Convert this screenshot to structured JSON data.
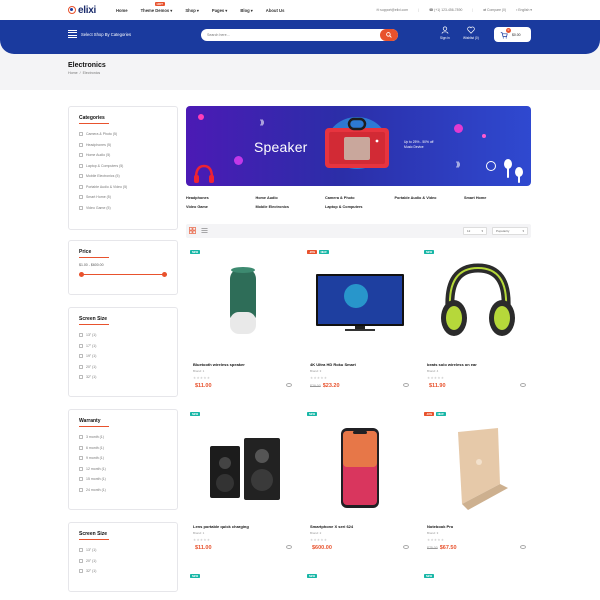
{
  "brand": {
    "logo_text": "elixi"
  },
  "nav": {
    "items": [
      {
        "label": "Home"
      },
      {
        "label": "Theme Demos"
      },
      {
        "label": "Shop"
      },
      {
        "label": "Pages"
      },
      {
        "label": "Blog"
      },
      {
        "label": "About Us"
      }
    ],
    "hot_label": "HOT"
  },
  "toplinks": {
    "email": "support@elixi.com",
    "phone": "(+1) 123-456-7890",
    "compare": "Compare (0)",
    "language": "English"
  },
  "header": {
    "category_button": "Select Shop By Categories",
    "search_placeholder": "Search here...",
    "signin": "Sign in",
    "wishlist": "Wishlist (0)",
    "cart_count": "0",
    "cart_total": "$0.00"
  },
  "page": {
    "title": "Electronics",
    "breadcrumb_home": "Home",
    "breadcrumb_sep": "/",
    "breadcrumb_current": "Electronics"
  },
  "sidebar": {
    "categories": {
      "title": "Categories",
      "items": [
        "Camera & Photo (5)",
        "Headphones (5)",
        "Home Audio (5)",
        "Laptop & Computers (5)",
        "Mobile Electronics (5)",
        "Portable Audio & Video (5)",
        "Smart Home (5)",
        "Video Game (5)"
      ]
    },
    "price": {
      "title": "Price",
      "range": "$1.00 - $600.00"
    },
    "screen_size": {
      "title": "Screen Size",
      "items": [
        "13\" (1)",
        "17\" (1)",
        "19\" (1)",
        "20\" (1)",
        "32\" (1)"
      ]
    },
    "warranty": {
      "title": "Warranty",
      "items": [
        "3 month (1)",
        "6 month (1)",
        "9 month (1)",
        "12 month (1)",
        "15 month (1)",
        "24 month (1)"
      ]
    },
    "screen_size_2": {
      "title": "Screen Size",
      "items": [
        "13\" (1)",
        "20\" (1)",
        "32\" (1)"
      ]
    }
  },
  "banner": {
    "title": "Speaker",
    "offer_line1": "Up to 25% - 50% off",
    "offer_line2": "Music Device"
  },
  "category_links": [
    "Headphones",
    "Home Audio",
    "Camera & Photo",
    "Portable Audio & Video",
    "Smart Home",
    "Video Game",
    "Mobile Electronics",
    "Laptop & Computers"
  ],
  "toolbar": {
    "show_value": "12",
    "sort_value": "Popularity"
  },
  "products": [
    {
      "name": "Bluetooth wireless speaker",
      "brand": "Brand: 1",
      "price": "$11.00",
      "old_price": "",
      "badges": [
        "NEW"
      ]
    },
    {
      "name": "4K Ultra HD Roku Smart",
      "brand": "Brand: 3",
      "price": "$23.20",
      "old_price": "$29.00",
      "badges": [
        "-20%",
        "NEW"
      ]
    },
    {
      "name": "beats solo wireless on ear",
      "brand": "Brand: 4",
      "price": "$11.90",
      "old_price": "",
      "badges": [
        "NEW"
      ]
    },
    {
      "name": "Lens portable quick charging",
      "brand": "Brand: 1",
      "price": "$11.00",
      "old_price": "",
      "badges": [
        "NEW"
      ]
    },
    {
      "name": "Smartphone X seri 624",
      "brand": "Brand: 2",
      "price": "$600.00",
      "old_price": "",
      "badges": [
        "NEW"
      ]
    },
    {
      "name": "Notebook Pro",
      "brand": "Brand: 3",
      "price": "$67.50",
      "old_price": "$75.00",
      "badges": [
        "-10%",
        "NEW"
      ]
    },
    {
      "name": "",
      "brand": "",
      "price": "",
      "old_price": "",
      "badges": [
        "NEW"
      ]
    },
    {
      "name": "",
      "brand": "",
      "price": "",
      "old_price": "",
      "badges": [
        "NEW"
      ]
    },
    {
      "name": "",
      "brand": "",
      "price": "",
      "old_price": "",
      "badges": [
        "NEW"
      ]
    }
  ],
  "colors": {
    "primary": "#1a3a9e",
    "accent": "#e8522d",
    "badge_new": "#17b6a6"
  }
}
